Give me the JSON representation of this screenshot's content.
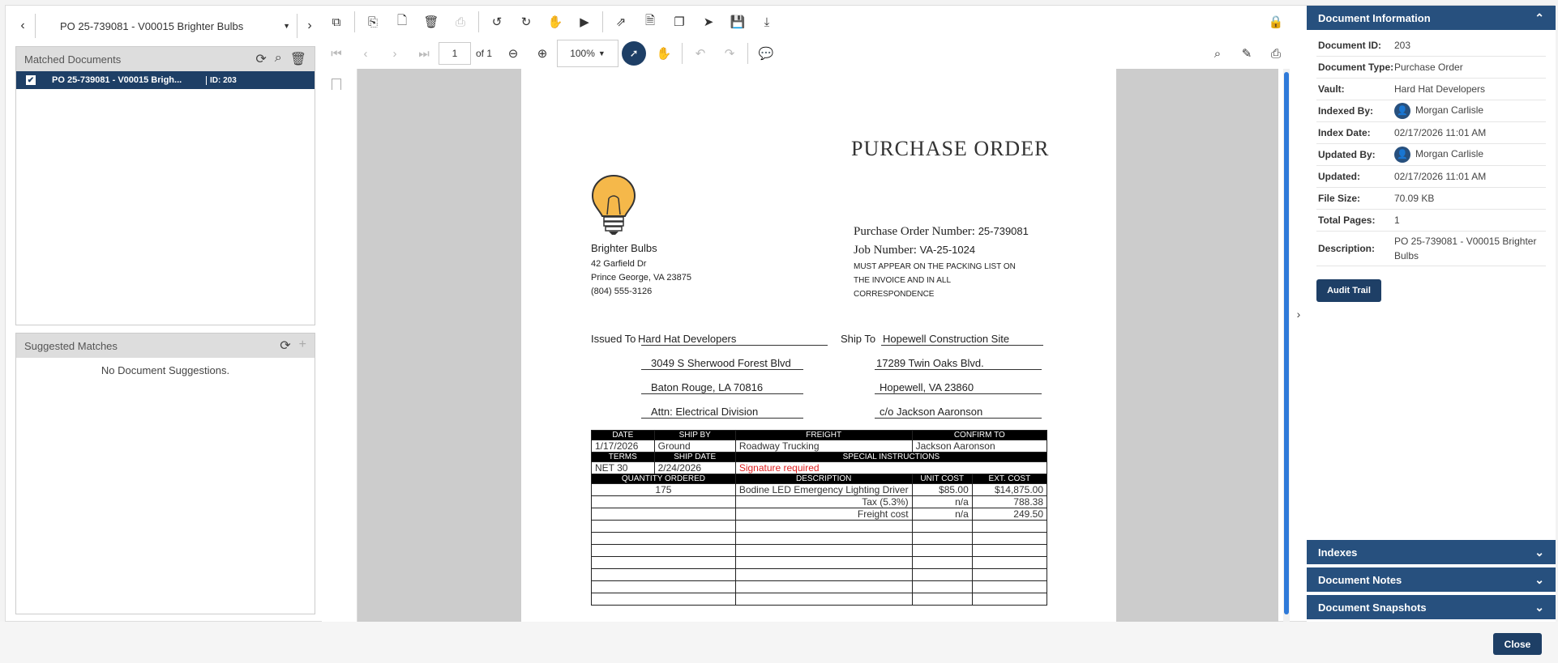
{
  "nav": {
    "doc_title": "PO 25-739081 - V00015 Brighter Bulbs"
  },
  "matched": {
    "title": "Matched Documents",
    "rows": [
      {
        "name": "PO 25-739081 - V00015 Brigh...",
        "id": "ID: 203"
      }
    ]
  },
  "suggested": {
    "title": "Suggested Matches",
    "empty": "No Document Suggestions."
  },
  "toolbar": {
    "page": "1",
    "of": "of 1",
    "zoom": "100%"
  },
  "document": {
    "title": "PURCHASE ORDER",
    "vendor": {
      "name": "Brighter Bulbs",
      "addr1": "42 Garfield Dr",
      "addr2": "Prince George, VA 23875",
      "phone": "(804) 555-3126"
    },
    "po_label": "Purchase Order Number:",
    "po_value": "25-739081",
    "job_label": "Job Number:",
    "job_value": "VA-25-1024",
    "notice": "MUST APPEAR ON THE PACKING LIST ON THE INVOICE AND IN ALL CORRESPONDENCE",
    "issued_label": "Issued To",
    "issued": [
      "Hard Hat Developers",
      "3049 S Sherwood Forest Blvd",
      "Baton Rouge, LA 70816",
      "Attn: Electrical Division"
    ],
    "ship_label": "Ship To",
    "ship": [
      "Hopewell Construction Site",
      "17289 Twin Oaks Blvd.",
      "Hopewell, VA 23860",
      "c/o Jackson Aaronson"
    ],
    "h1": [
      "DATE",
      "SHIP BY",
      "FREIGHT",
      "CONFIRM TO"
    ],
    "r1": [
      "1/17/2026",
      "Ground",
      "Roadway Trucking",
      "Jackson Aaronson"
    ],
    "h2": [
      "TERMS",
      "SHIP DATE",
      "SPECIAL INSTRUCTIONS"
    ],
    "r2": [
      "NET 30",
      "2/24/2026",
      "Signature required"
    ],
    "h3": [
      "QUANTITY ORDERED",
      "DESCRIPTION",
      "UNIT COST",
      "EXT. COST"
    ],
    "items": [
      [
        "175",
        "Bodine LED Emergency Lighting Driver",
        "$85.00",
        "$14,875.00"
      ],
      [
        "",
        "Tax (5.3%)",
        "n/a",
        "788.38"
      ],
      [
        "",
        "Freight cost",
        "n/a",
        "249.50"
      ]
    ]
  },
  "info": {
    "title": "Document Information",
    "rows": [
      {
        "k": "Document ID:",
        "v": "203"
      },
      {
        "k": "Document Type:",
        "v": "Purchase Order"
      },
      {
        "k": "Vault:",
        "v": "Hard Hat Developers"
      },
      {
        "k": "Indexed By:",
        "v": "Morgan Carlisle"
      },
      {
        "k": "Index Date:",
        "v": "02/17/2026 11:01 AM"
      },
      {
        "k": "Updated By:",
        "v": "Morgan Carlisle"
      },
      {
        "k": "Updated:",
        "v": "02/17/2026 11:01 AM"
      },
      {
        "k": "File Size:",
        "v": "70.09 KB"
      },
      {
        "k": "Total Pages:",
        "v": "1"
      },
      {
        "k": "Description:",
        "v": "PO 25-739081 - V00015 Brighter Bulbs"
      }
    ],
    "audit": "Audit Trail"
  },
  "sections": [
    "Indexes",
    "Document Notes",
    "Document Snapshots"
  ],
  "footer": {
    "close": "Close"
  }
}
